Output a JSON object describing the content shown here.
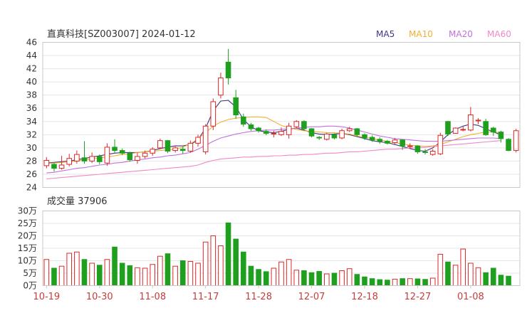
{
  "header": {
    "title": "直真科技[SZ003007] 2024-01-12",
    "legend": [
      {
        "label": "MA5",
        "color": "#3d3580"
      },
      {
        "label": "MA10",
        "color": "#f0b030"
      },
      {
        "label": "MA20",
        "color": "#c070e0"
      },
      {
        "label": "MA60",
        "color": "#f088c8"
      }
    ]
  },
  "volume_label": "成交量 37906",
  "colors": {
    "up": "#dc2828",
    "down": "#1ea01e"
  },
  "chart_data": [
    {
      "type": "candlestick",
      "title": "直真科技[SZ003007] 2024-01-12",
      "ylim": [
        24,
        46
      ],
      "yticks": [
        "24",
        "26",
        "28",
        "30",
        "32",
        "34",
        "36",
        "38",
        "40",
        "42",
        "44",
        "46"
      ],
      "xtick_labels": [
        "10-19",
        "10-30",
        "11-08",
        "11-17",
        "11-28",
        "12-07",
        "12-18",
        "12-27",
        "01-08"
      ],
      "xtick_index": [
        0,
        7,
        14,
        21,
        28,
        35,
        42,
        49,
        56
      ],
      "dates": [
        "10-19",
        "10-20",
        "10-23",
        "10-24",
        "10-25",
        "10-26",
        "10-27",
        "10-30",
        "10-31",
        "11-01",
        "11-02",
        "11-03",
        "11-06",
        "11-07",
        "11-08",
        "11-09",
        "11-10",
        "11-13",
        "11-14",
        "11-15",
        "11-16",
        "11-17",
        "11-20",
        "11-21",
        "11-22",
        "11-23",
        "11-24",
        "11-27",
        "11-28",
        "11-29",
        "11-30",
        "12-01",
        "12-04",
        "12-05",
        "12-06",
        "12-07",
        "12-08",
        "12-11",
        "12-12",
        "12-13",
        "12-14",
        "12-15",
        "12-18",
        "12-19",
        "12-20",
        "12-21",
        "12-22",
        "12-25",
        "12-26",
        "12-27",
        "12-28",
        "12-29",
        "01-02",
        "01-03",
        "01-04",
        "01-05",
        "01-08",
        "01-09",
        "01-10",
        "01-11",
        "01-12"
      ],
      "ohlc": [
        [
          27.3,
          28.1,
          26.9,
          28.6
        ],
        [
          27.5,
          26.9,
          26.4,
          27.7
        ],
        [
          26.9,
          27.4,
          26.7,
          28.8
        ],
        [
          27.5,
          28.4,
          27.2,
          29.1
        ],
        [
          28.0,
          29.0,
          27.6,
          29.6
        ],
        [
          28.5,
          28.0,
          27.6,
          31.0
        ],
        [
          28.0,
          28.7,
          27.7,
          29.3
        ],
        [
          28.7,
          27.9,
          27.5,
          29.0
        ],
        [
          27.7,
          30.1,
          27.3,
          30.7
        ],
        [
          30.1,
          29.6,
          29.2,
          31.3
        ],
        [
          29.6,
          29.2,
          28.9,
          29.9
        ],
        [
          29.2,
          28.2,
          27.9,
          29.4
        ],
        [
          28.1,
          28.7,
          27.6,
          29.3
        ],
        [
          28.7,
          29.2,
          28.4,
          29.6
        ],
        [
          29.2,
          29.8,
          28.8,
          30.1
        ],
        [
          30.0,
          31.1,
          29.8,
          31.4
        ],
        [
          31.1,
          29.5,
          29.2,
          31.2
        ],
        [
          29.6,
          30.0,
          29.3,
          30.3
        ],
        [
          29.8,
          29.6,
          29.1,
          30.2
        ],
        [
          29.5,
          30.7,
          29.3,
          31.1
        ],
        [
          30.7,
          31.6,
          30.2,
          32.0
        ],
        [
          29.4,
          33.3,
          29.0,
          33.6
        ],
        [
          33.3,
          37.0,
          32.7,
          37.5
        ],
        [
          38.0,
          40.6,
          37.5,
          41.4
        ],
        [
          43.0,
          40.6,
          39.6,
          45.0
        ],
        [
          37.6,
          35.0,
          34.4,
          38.8
        ],
        [
          34.7,
          33.6,
          33.2,
          35.2
        ],
        [
          33.5,
          32.9,
          32.6,
          33.8
        ],
        [
          33.0,
          32.6,
          32.3,
          33.2
        ],
        [
          32.5,
          32.2,
          31.9,
          32.8
        ],
        [
          32.1,
          32.2,
          31.6,
          32.6
        ],
        [
          32.0,
          32.5,
          31.8,
          33.1
        ],
        [
          32.0,
          33.3,
          31.4,
          33.8
        ],
        [
          33.2,
          34.0,
          32.9,
          34.2
        ],
        [
          34.0,
          32.9,
          32.6,
          34.2
        ],
        [
          32.9,
          31.8,
          31.6,
          33.0
        ],
        [
          31.6,
          31.5,
          31.2,
          31.8
        ],
        [
          31.3,
          32.1,
          31.1,
          32.3
        ],
        [
          32.0,
          31.5,
          31.3,
          32.2
        ],
        [
          31.5,
          32.6,
          31.3,
          32.9
        ],
        [
          32.6,
          32.9,
          32.4,
          33.2
        ],
        [
          32.9,
          32.0,
          31.7,
          33.0
        ],
        [
          32.0,
          31.5,
          31.2,
          32.2
        ],
        [
          31.6,
          31.2,
          30.9,
          31.9
        ],
        [
          31.3,
          31.0,
          30.6,
          31.6
        ],
        [
          31.0,
          30.7,
          30.5,
          31.2
        ],
        [
          30.8,
          31.2,
          30.6,
          31.5
        ],
        [
          31.2,
          30.3,
          29.7,
          31.3
        ],
        [
          30.2,
          30.3,
          29.9,
          30.7
        ],
        [
          30.3,
          29.4,
          29.1,
          30.4
        ],
        [
          29.4,
          29.3,
          29.0,
          29.8
        ],
        [
          29.0,
          29.5,
          28.8,
          29.8
        ],
        [
          29.1,
          31.9,
          28.9,
          32.3
        ],
        [
          34.0,
          32.1,
          31.8,
          34.1
        ],
        [
          32.2,
          33.0,
          32.2,
          33.1
        ],
        [
          32.8,
          32.8,
          32.5,
          33.2
        ],
        [
          32.7,
          35.0,
          32.5,
          36.2
        ],
        [
          34.1,
          34.2,
          33.6,
          34.5
        ],
        [
          34.0,
          32.0,
          31.8,
          34.4
        ],
        [
          33.0,
          32.4,
          31.8,
          33.2
        ],
        [
          32.4,
          31.4,
          30.8,
          32.6
        ],
        [
          31.3,
          29.6,
          29.5,
          31.5
        ],
        [
          29.6,
          32.6,
          29.3,
          32.9
        ]
      ],
      "series": [
        {
          "name": "MA5",
          "values": [
            27.7,
            27.8,
            27.9,
            28.0,
            28.2,
            28.4,
            28.6,
            28.8,
            29.0,
            29.2,
            29.3,
            29.3,
            29.3,
            29.4,
            29.6,
            29.9,
            30.1,
            30.3,
            30.3,
            30.5,
            31.2,
            33.0,
            35.6,
            37.1,
            37.2,
            36.2,
            34.3,
            33.2,
            32.6,
            32.4,
            32.3,
            32.5,
            32.8,
            33.0,
            32.7,
            32.3,
            32.1,
            32.0,
            32.1,
            32.2,
            32.0,
            31.7,
            31.4,
            31.1,
            30.9,
            30.8,
            30.5,
            30.2,
            29.9,
            29.6,
            29.5,
            30.0,
            30.9,
            32.0,
            32.8,
            33.3,
            33.6,
            33.4,
            32.9,
            32.4,
            32.0
          ]
        },
        {
          "name": "MA10",
          "values": [
            27.6,
            27.7,
            27.8,
            27.9,
            28.0,
            28.2,
            28.3,
            28.5,
            28.6,
            28.8,
            29.0,
            29.1,
            29.3,
            29.4,
            29.5,
            29.6,
            29.7,
            29.8,
            30.1,
            30.6,
            31.4,
            32.3,
            33.3,
            33.9,
            34.3,
            34.5,
            34.6,
            34.7,
            34.7,
            34.6,
            34.0,
            33.4,
            33.0,
            32.8,
            32.6,
            32.5,
            32.4,
            32.3,
            32.3,
            32.2,
            32.1,
            31.8,
            31.6,
            31.4,
            31.2,
            31.0,
            30.8,
            30.6,
            30.4,
            30.3,
            30.2,
            30.3,
            30.5,
            30.9,
            31.3,
            31.7,
            32.0,
            32.2,
            32.4,
            32.4,
            32.3
          ]
        },
        {
          "name": "MA20",
          "values": [
            26.2,
            26.3,
            26.5,
            26.7,
            26.9,
            27.0,
            27.2,
            27.4,
            27.5,
            27.7,
            27.8,
            28.0,
            28.2,
            28.3,
            28.5,
            28.6,
            28.8,
            28.9,
            29.1,
            29.3,
            29.8,
            30.4,
            31.0,
            31.5,
            31.8,
            32.1,
            32.3,
            32.5,
            32.6,
            32.7,
            32.7,
            32.8,
            32.9,
            33.0,
            33.1,
            33.2,
            33.2,
            33.3,
            33.3,
            33.2,
            33.0,
            32.7,
            32.4,
            32.1,
            31.8,
            31.6,
            31.4,
            31.3,
            31.2,
            31.1,
            31.0,
            31.0,
            31.0,
            31.1,
            31.2,
            31.3,
            31.4,
            31.5,
            31.5,
            31.5,
            31.4
          ]
        },
        {
          "name": "MA60",
          "values": [
            25.3,
            25.4,
            25.5,
            25.6,
            25.7,
            25.8,
            25.9,
            26.0,
            26.1,
            26.2,
            26.3,
            26.4,
            26.5,
            26.6,
            26.7,
            26.8,
            26.9,
            27.0,
            27.1,
            27.2,
            27.4,
            27.8,
            28.1,
            28.3,
            28.4,
            28.5,
            28.6,
            28.6,
            28.7,
            28.7,
            28.8,
            28.8,
            28.9,
            28.9,
            29.0,
            29.0,
            29.1,
            29.2,
            29.2,
            29.3,
            29.4,
            29.4,
            29.5,
            29.6,
            29.7,
            29.8,
            29.8,
            29.9,
            30.0,
            30.0,
            30.1,
            30.2,
            30.3,
            30.4,
            30.5,
            30.6,
            30.7,
            30.8,
            30.9,
            31.0,
            31.1
          ]
        }
      ]
    },
    {
      "type": "bar",
      "title": "成交量 37906",
      "ylim": [
        0,
        300000
      ],
      "yticks": [
        "0万",
        "5万",
        "10万",
        "15万",
        "20万",
        "25万",
        "30万"
      ],
      "series": [
        {
          "name": "成交量",
          "values": [
            105000,
            70000,
            78000,
            130000,
            135000,
            105000,
            90000,
            82000,
            105000,
            155000,
            90000,
            80000,
            72000,
            70000,
            85000,
            118000,
            128000,
            78000,
            100000,
            97000,
            90000,
            175000,
            200000,
            160000,
            252000,
            187000,
            135000,
            78000,
            65000,
            56000,
            70000,
            95000,
            105000,
            62000,
            60000,
            52000,
            57000,
            47000,
            50000,
            60000,
            68000,
            45000,
            35000,
            28000,
            24000,
            22000,
            26000,
            28000,
            28000,
            27000,
            25000,
            30000,
            126000,
            95000,
            82000,
            147000,
            90000,
            72000,
            52000,
            70000,
            42000,
            37906
          ]
        }
      ]
    }
  ]
}
